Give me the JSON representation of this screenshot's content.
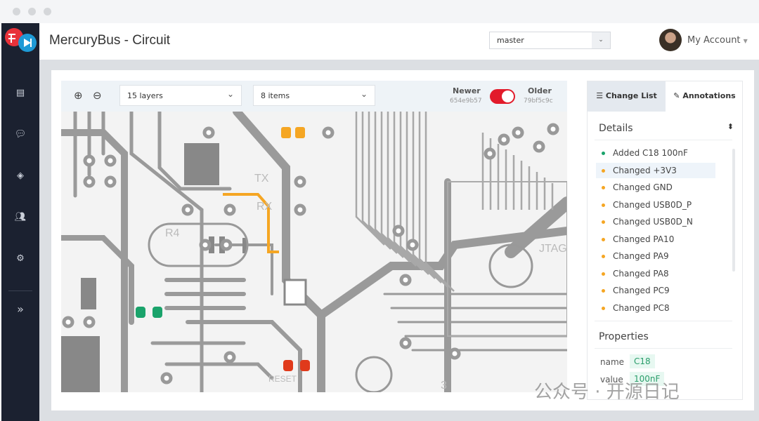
{
  "app": {
    "title": "MercuryBus - Circuit",
    "logo_text": "MercuryBus"
  },
  "header": {
    "branch": "master",
    "account": "My Account"
  },
  "sidebar": {
    "items": [
      {
        "icon": "document-icon"
      },
      {
        "icon": "chat-icon"
      },
      {
        "icon": "layers-icon"
      },
      {
        "icon": "users-icon"
      },
      {
        "icon": "gear-icon"
      },
      {
        "icon": "expand-icon"
      }
    ]
  },
  "toolbar": {
    "layers": "15 layers",
    "items": "8 items",
    "newer_label": "Newer",
    "newer_hash": "654e9b57",
    "older_label": "Older",
    "older_hash": "79bf5c9c",
    "toggle_on": true
  },
  "panel": {
    "tabs": [
      {
        "label": "Change List",
        "icon": "list-icon",
        "active": true
      },
      {
        "label": "Annotations",
        "icon": "pen-icon"
      }
    ],
    "details_title": "Details",
    "changes": [
      {
        "text": "Added C18 100nF",
        "color": "#1aa36b"
      },
      {
        "text": "Changed +3V3",
        "color": "#f5a623",
        "selected": true
      },
      {
        "text": "Changed GND",
        "color": "#f5a623"
      },
      {
        "text": "Changed USB0D_P",
        "color": "#f5a623"
      },
      {
        "text": "Changed USB0D_N",
        "color": "#f5a623"
      },
      {
        "text": "Changed PA10",
        "color": "#f5a623"
      },
      {
        "text": "Changed PA9",
        "color": "#f5a623"
      },
      {
        "text": "Changed PA8",
        "color": "#f5a623"
      },
      {
        "text": "Changed PC9",
        "color": "#f5a623"
      },
      {
        "text": "Changed PC8",
        "color": "#f5a623"
      }
    ],
    "properties_title": "Properties",
    "properties": [
      {
        "key": "name",
        "value": "C18"
      },
      {
        "key": "value",
        "value": "100nF"
      }
    ]
  },
  "pcb": {
    "labels": [
      "TX",
      "RX",
      "R4",
      "RESET",
      "JTAG",
      "3"
    ]
  },
  "watermark": "公众号 · 开源日记"
}
